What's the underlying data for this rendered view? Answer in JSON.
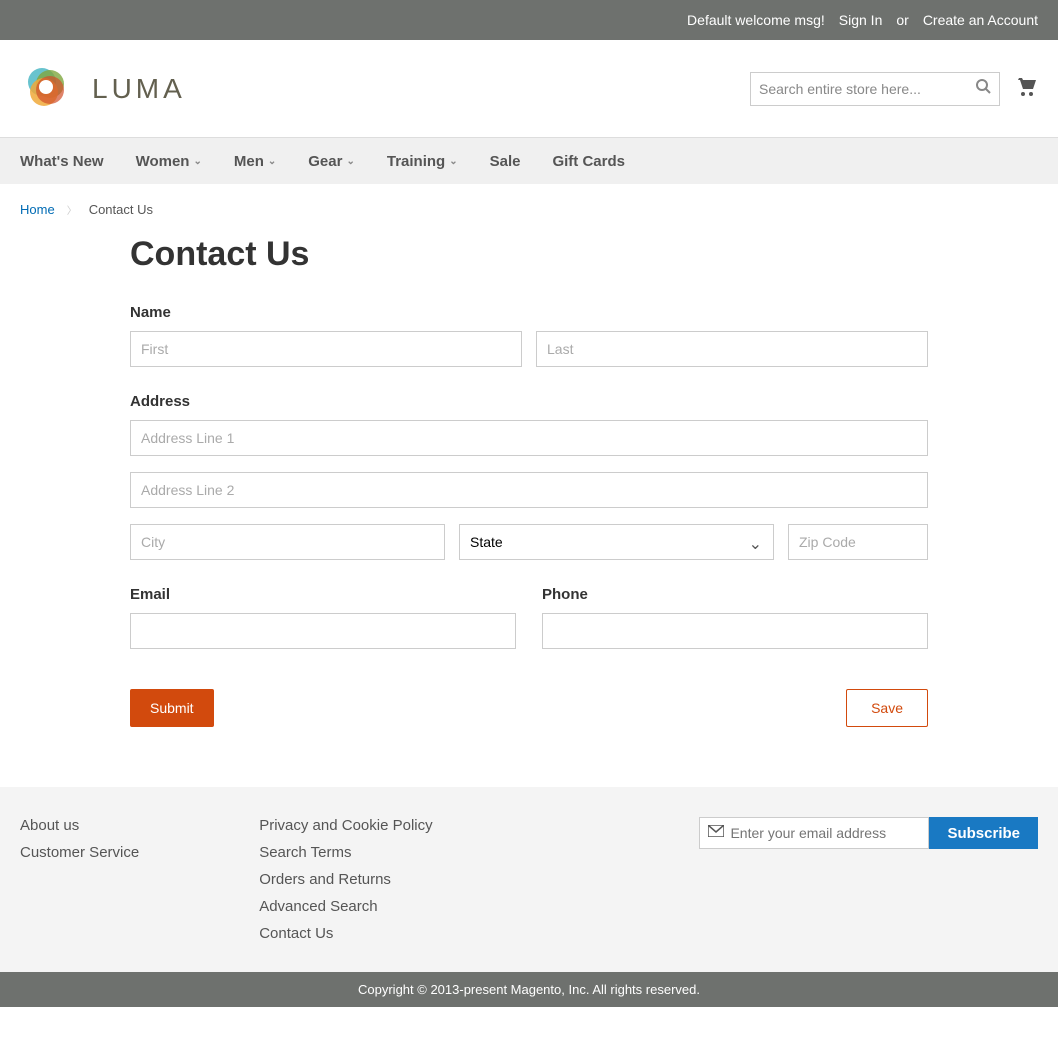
{
  "topbar": {
    "welcome": "Default welcome msg!",
    "signin": "Sign In",
    "or": "or",
    "create": "Create an Account"
  },
  "header": {
    "logo_text": "LUMA",
    "search_placeholder": "Search entire store here..."
  },
  "nav": {
    "items": [
      {
        "label": "What's New",
        "dropdown": false
      },
      {
        "label": "Women",
        "dropdown": true
      },
      {
        "label": "Men",
        "dropdown": true
      },
      {
        "label": "Gear",
        "dropdown": true
      },
      {
        "label": "Training",
        "dropdown": true
      },
      {
        "label": "Sale",
        "dropdown": false
      },
      {
        "label": "Gift Cards",
        "dropdown": false
      }
    ]
  },
  "breadcrumb": {
    "home": "Home",
    "current": "Contact Us"
  },
  "page": {
    "title": "Contact Us",
    "form": {
      "name_label": "Name",
      "first_placeholder": "First",
      "last_placeholder": "Last",
      "address_label": "Address",
      "addr1_placeholder": "Address Line 1",
      "addr2_placeholder": "Address Line 2",
      "city_placeholder": "City",
      "state_placeholder": "State",
      "zip_placeholder": "Zip Code",
      "email_label": "Email",
      "phone_label": "Phone",
      "submit_label": "Submit",
      "save_label": "Save"
    }
  },
  "footer": {
    "col1": [
      "About us",
      "Customer Service"
    ],
    "col2": [
      "Privacy and Cookie Policy",
      "Search Terms",
      "Orders and Returns",
      "Advanced Search",
      "Contact Us"
    ],
    "newsletter_placeholder": "Enter your email address",
    "subscribe_label": "Subscribe"
  },
  "copyright": "Copyright © 2013-present Magento, Inc. All rights reserved."
}
